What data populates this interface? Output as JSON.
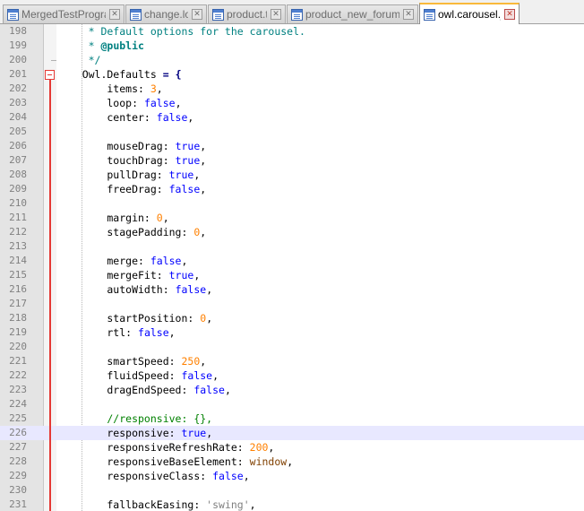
{
  "tabs": [
    {
      "label": "MergedTestProgram",
      "active": false
    },
    {
      "label": "change.log",
      "active": false
    },
    {
      "label": "product.tpl",
      "active": false
    },
    {
      "label": "product_new_forum.tpl",
      "active": false
    },
    {
      "label": "owl.carousel.js",
      "active": true
    }
  ],
  "editor": {
    "current_line": 226,
    "colors": {
      "current_line_bg": "#e8e8ff",
      "keyword": "#0000ff",
      "number": "#ff8000",
      "comment": "#008080",
      "fold_marker": "#e53935"
    },
    "lines": [
      {
        "n": "198",
        "tokens": [
          {
            "t": "     * Default options for the carousel.",
            "c": "cmt"
          }
        ]
      },
      {
        "n": "199",
        "tokens": [
          {
            "t": "     * ",
            "c": "cmt"
          },
          {
            "t": "@public",
            "c": "tag"
          }
        ]
      },
      {
        "n": "200",
        "tokens": [
          {
            "t": "     */",
            "c": "cmt"
          }
        ]
      },
      {
        "n": "201",
        "tokens": [
          {
            "t": "    Owl.Defaults ",
            "c": "default"
          },
          {
            "t": "=",
            "c": "op"
          },
          {
            "t": " {",
            "c": "op"
          }
        ]
      },
      {
        "n": "202",
        "tokens": [
          {
            "t": "        items: ",
            "c": "default"
          },
          {
            "t": "3",
            "c": "num"
          },
          {
            "t": ",",
            "c": "default"
          }
        ]
      },
      {
        "n": "203",
        "tokens": [
          {
            "t": "        loop: ",
            "c": "default"
          },
          {
            "t": "false",
            "c": "kw"
          },
          {
            "t": ",",
            "c": "default"
          }
        ]
      },
      {
        "n": "204",
        "tokens": [
          {
            "t": "        center: ",
            "c": "default"
          },
          {
            "t": "false",
            "c": "kw"
          },
          {
            "t": ",",
            "c": "default"
          }
        ]
      },
      {
        "n": "205",
        "tokens": []
      },
      {
        "n": "206",
        "tokens": [
          {
            "t": "        mouseDrag: ",
            "c": "default"
          },
          {
            "t": "true",
            "c": "kw"
          },
          {
            "t": ",",
            "c": "default"
          }
        ]
      },
      {
        "n": "207",
        "tokens": [
          {
            "t": "        touchDrag: ",
            "c": "default"
          },
          {
            "t": "true",
            "c": "kw"
          },
          {
            "t": ",",
            "c": "default"
          }
        ]
      },
      {
        "n": "208",
        "tokens": [
          {
            "t": "        pullDrag: ",
            "c": "default"
          },
          {
            "t": "true",
            "c": "kw"
          },
          {
            "t": ",",
            "c": "default"
          }
        ]
      },
      {
        "n": "209",
        "tokens": [
          {
            "t": "        freeDrag: ",
            "c": "default"
          },
          {
            "t": "false",
            "c": "kw"
          },
          {
            "t": ",",
            "c": "default"
          }
        ]
      },
      {
        "n": "210",
        "tokens": []
      },
      {
        "n": "211",
        "tokens": [
          {
            "t": "        margin: ",
            "c": "default"
          },
          {
            "t": "0",
            "c": "num"
          },
          {
            "t": ",",
            "c": "default"
          }
        ]
      },
      {
        "n": "212",
        "tokens": [
          {
            "t": "        stagePadding: ",
            "c": "default"
          },
          {
            "t": "0",
            "c": "num"
          },
          {
            "t": ",",
            "c": "default"
          }
        ]
      },
      {
        "n": "213",
        "tokens": []
      },
      {
        "n": "214",
        "tokens": [
          {
            "t": "        merge: ",
            "c": "default"
          },
          {
            "t": "false",
            "c": "kw"
          },
          {
            "t": ",",
            "c": "default"
          }
        ]
      },
      {
        "n": "215",
        "tokens": [
          {
            "t": "        mergeFit: ",
            "c": "default"
          },
          {
            "t": "true",
            "c": "kw"
          },
          {
            "t": ",",
            "c": "default"
          }
        ]
      },
      {
        "n": "216",
        "tokens": [
          {
            "t": "        autoWidth: ",
            "c": "default"
          },
          {
            "t": "false",
            "c": "kw"
          },
          {
            "t": ",",
            "c": "default"
          }
        ]
      },
      {
        "n": "217",
        "tokens": []
      },
      {
        "n": "218",
        "tokens": [
          {
            "t": "        startPosition: ",
            "c": "default"
          },
          {
            "t": "0",
            "c": "num"
          },
          {
            "t": ",",
            "c": "default"
          }
        ]
      },
      {
        "n": "219",
        "tokens": [
          {
            "t": "        rtl: ",
            "c": "default"
          },
          {
            "t": "false",
            "c": "kw"
          },
          {
            "t": ",",
            "c": "default"
          }
        ]
      },
      {
        "n": "220",
        "tokens": []
      },
      {
        "n": "221",
        "tokens": [
          {
            "t": "        smartSpeed: ",
            "c": "default"
          },
          {
            "t": "250",
            "c": "num"
          },
          {
            "t": ",",
            "c": "default"
          }
        ]
      },
      {
        "n": "222",
        "tokens": [
          {
            "t": "        fluidSpeed: ",
            "c": "default"
          },
          {
            "t": "false",
            "c": "kw"
          },
          {
            "t": ",",
            "c": "default"
          }
        ]
      },
      {
        "n": "223",
        "tokens": [
          {
            "t": "        dragEndSpeed: ",
            "c": "default"
          },
          {
            "t": "false",
            "c": "kw"
          },
          {
            "t": ",",
            "c": "default"
          }
        ]
      },
      {
        "n": "224",
        "tokens": []
      },
      {
        "n": "225",
        "tokens": [
          {
            "t": "        //responsive: {},",
            "c": "green"
          }
        ]
      },
      {
        "n": "226",
        "tokens": [
          {
            "t": "        responsive: ",
            "c": "default"
          },
          {
            "t": "true",
            "c": "kw"
          },
          {
            "t": ",",
            "c": "default"
          }
        ]
      },
      {
        "n": "227",
        "tokens": [
          {
            "t": "        responsiveRefreshRate: ",
            "c": "default"
          },
          {
            "t": "200",
            "c": "num"
          },
          {
            "t": ",",
            "c": "default"
          }
        ]
      },
      {
        "n": "228",
        "tokens": [
          {
            "t": "        responsiveBaseElement: ",
            "c": "default"
          },
          {
            "t": "window",
            "c": "obj"
          },
          {
            "t": ",",
            "c": "default"
          }
        ]
      },
      {
        "n": "229",
        "tokens": [
          {
            "t": "        responsiveClass: ",
            "c": "default"
          },
          {
            "t": "false",
            "c": "kw"
          },
          {
            "t": ",",
            "c": "default"
          }
        ]
      },
      {
        "n": "230",
        "tokens": []
      },
      {
        "n": "231",
        "tokens": [
          {
            "t": "        fallbackEasing: ",
            "c": "default"
          },
          {
            "t": "'swing'",
            "c": "str"
          },
          {
            "t": ",",
            "c": "default"
          }
        ]
      }
    ]
  }
}
